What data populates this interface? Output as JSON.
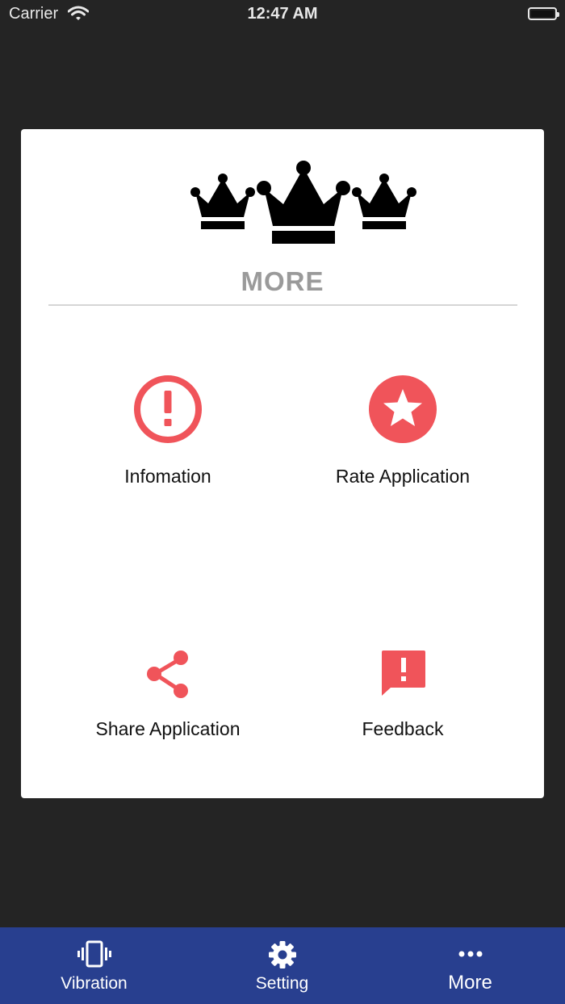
{
  "status_bar": {
    "carrier": "Carrier",
    "time": "12:47 AM"
  },
  "card": {
    "title": "MORE",
    "items": [
      {
        "label": "Infomation",
        "icon": "alert-circle-icon"
      },
      {
        "label": "Rate Application",
        "icon": "star-circle-icon"
      },
      {
        "label": "Share Application",
        "icon": "share-icon"
      },
      {
        "label": "Feedback",
        "icon": "feedback-icon"
      }
    ]
  },
  "tab_bar": {
    "tabs": [
      {
        "label": "Vibration",
        "icon": "vibration-icon"
      },
      {
        "label": "Setting",
        "icon": "gear-icon"
      },
      {
        "label": "More",
        "icon": "more-dots-icon"
      }
    ]
  },
  "colors": {
    "background": "#242424",
    "card": "#ffffff",
    "accent": "#f0545a",
    "tab_bar": "#283f8f",
    "title_gray": "#9a9a9a"
  }
}
